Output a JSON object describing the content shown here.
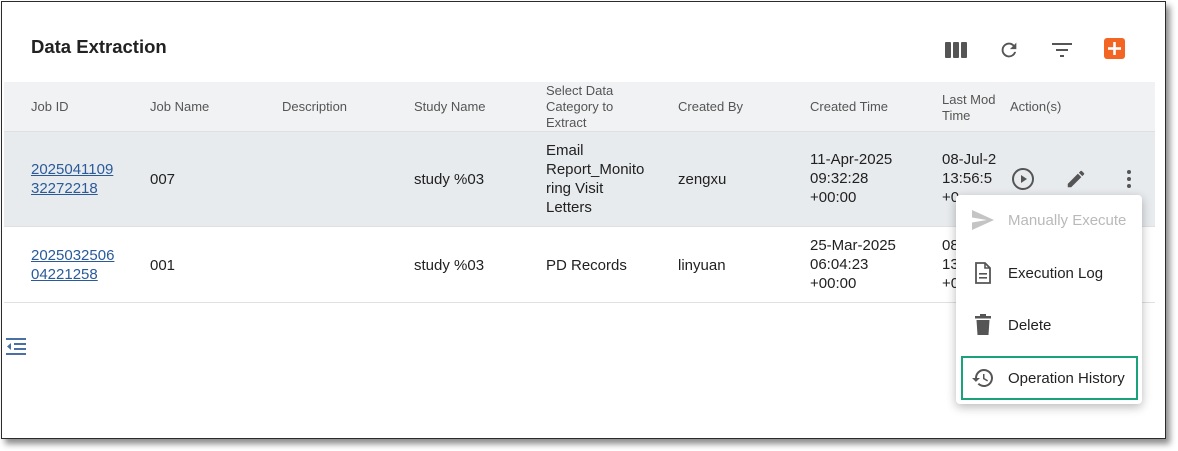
{
  "page": {
    "title": "Data Extraction"
  },
  "toolbar": {
    "columns_icon": "columns-icon",
    "refresh_icon": "refresh-icon",
    "filter_icon": "filter-icon",
    "add_icon": "add-icon",
    "accent": "#f26522"
  },
  "table": {
    "headers": {
      "job_id": "Job ID",
      "job_name": "Job Name",
      "description": "Description",
      "study_name": "Study Name",
      "category": [
        "Select Data",
        "Category to",
        "Extract"
      ],
      "created_by": "Created By",
      "created_time": "Created Time",
      "last_modified": [
        "Last Mod",
        "Time"
      ],
      "actions": "Action(s)"
    },
    "rows": [
      {
        "job_id": [
          "2025041109",
          "32272218"
        ],
        "job_name": "007",
        "description": "",
        "study_name": "study %03",
        "category": [
          "Email",
          "Report_Monito",
          "ring Visit",
          "Letters"
        ],
        "created_by": "zengxu",
        "created_time": [
          "11-Apr-2025",
          "09:32:28",
          "+00:00"
        ],
        "last_modified": [
          "08-Jul-2",
          "13:56:5",
          "+0"
        ]
      },
      {
        "job_id": [
          "2025032506",
          "04221258"
        ],
        "job_name": "001",
        "description": "",
        "study_name": "study %03",
        "category": [
          "PD Records"
        ],
        "created_by": "linyuan",
        "created_time": [
          "25-Mar-2025",
          "06:04:23",
          "+00:00"
        ],
        "last_modified": [
          "08",
          "13",
          "+0"
        ]
      }
    ]
  },
  "menu": {
    "items": [
      {
        "label": "Manually Execute",
        "icon": "send-icon",
        "disabled": true
      },
      {
        "label": "Execution Log",
        "icon": "document-icon",
        "disabled": false
      },
      {
        "label": "Delete",
        "icon": "trash-icon",
        "disabled": false
      },
      {
        "label": "Operation History",
        "icon": "history-icon",
        "disabled": false,
        "highlighted": true
      }
    ],
    "highlight_color": "#1aa37a"
  }
}
